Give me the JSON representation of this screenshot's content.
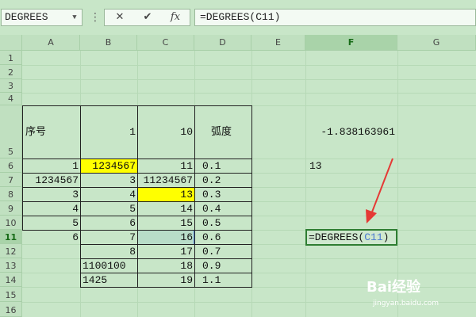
{
  "toolbar": {
    "name_box": "DEGREES",
    "dots": "⋮",
    "cancel_glyph": "✕",
    "confirm_glyph": "✔",
    "fx_glyph": "fx",
    "formula": "=DEGREES(C11)"
  },
  "columns": [
    "A",
    "B",
    "C",
    "D",
    "E",
    "F",
    "G"
  ],
  "rows": [
    "1",
    "2",
    "3",
    "4",
    "5",
    "6",
    "7",
    "8",
    "9",
    "10",
    "11",
    "12",
    "13",
    "14",
    "15",
    "16"
  ],
  "active_row": "11",
  "cells": {
    "a5": "序号",
    "b5": "1",
    "c5": "10",
    "d5": "弧度",
    "f5": "-1.838163961",
    "a6": "1",
    "b6": "1234567",
    "c6": "11",
    "d6": "0.1",
    "f6": "13",
    "a7": "1234567",
    "b7": "3",
    "c7": "11234567",
    "d7": "0.2",
    "a8": "3",
    "b8": "4",
    "c8": "13",
    "d8": "0.3",
    "a9": "4",
    "b9": "5",
    "c9": "14",
    "d9": "0.4",
    "a10": "5",
    "b10": "6",
    "c10": "15",
    "d10": "0.5",
    "a11": "6",
    "b11": "7",
    "c11": "16",
    "d11": "0.6",
    "b12": "8",
    "c12": "17",
    "d12": "0.7",
    "b13": "1100100",
    "c13": "18",
    "d13": "0.9",
    "b14": "1425",
    "c14": "19",
    "d14": "1.1"
  },
  "editing": {
    "prefix": "=DEGREES(",
    "ref": "C11",
    "suffix": ")"
  },
  "colors": {
    "highlight": "#ffff00",
    "ref": "#4a7bd0",
    "arrow": "#e53935"
  },
  "watermark": {
    "brand": "Bai经验",
    "url": "jingyan.baidu.com"
  }
}
